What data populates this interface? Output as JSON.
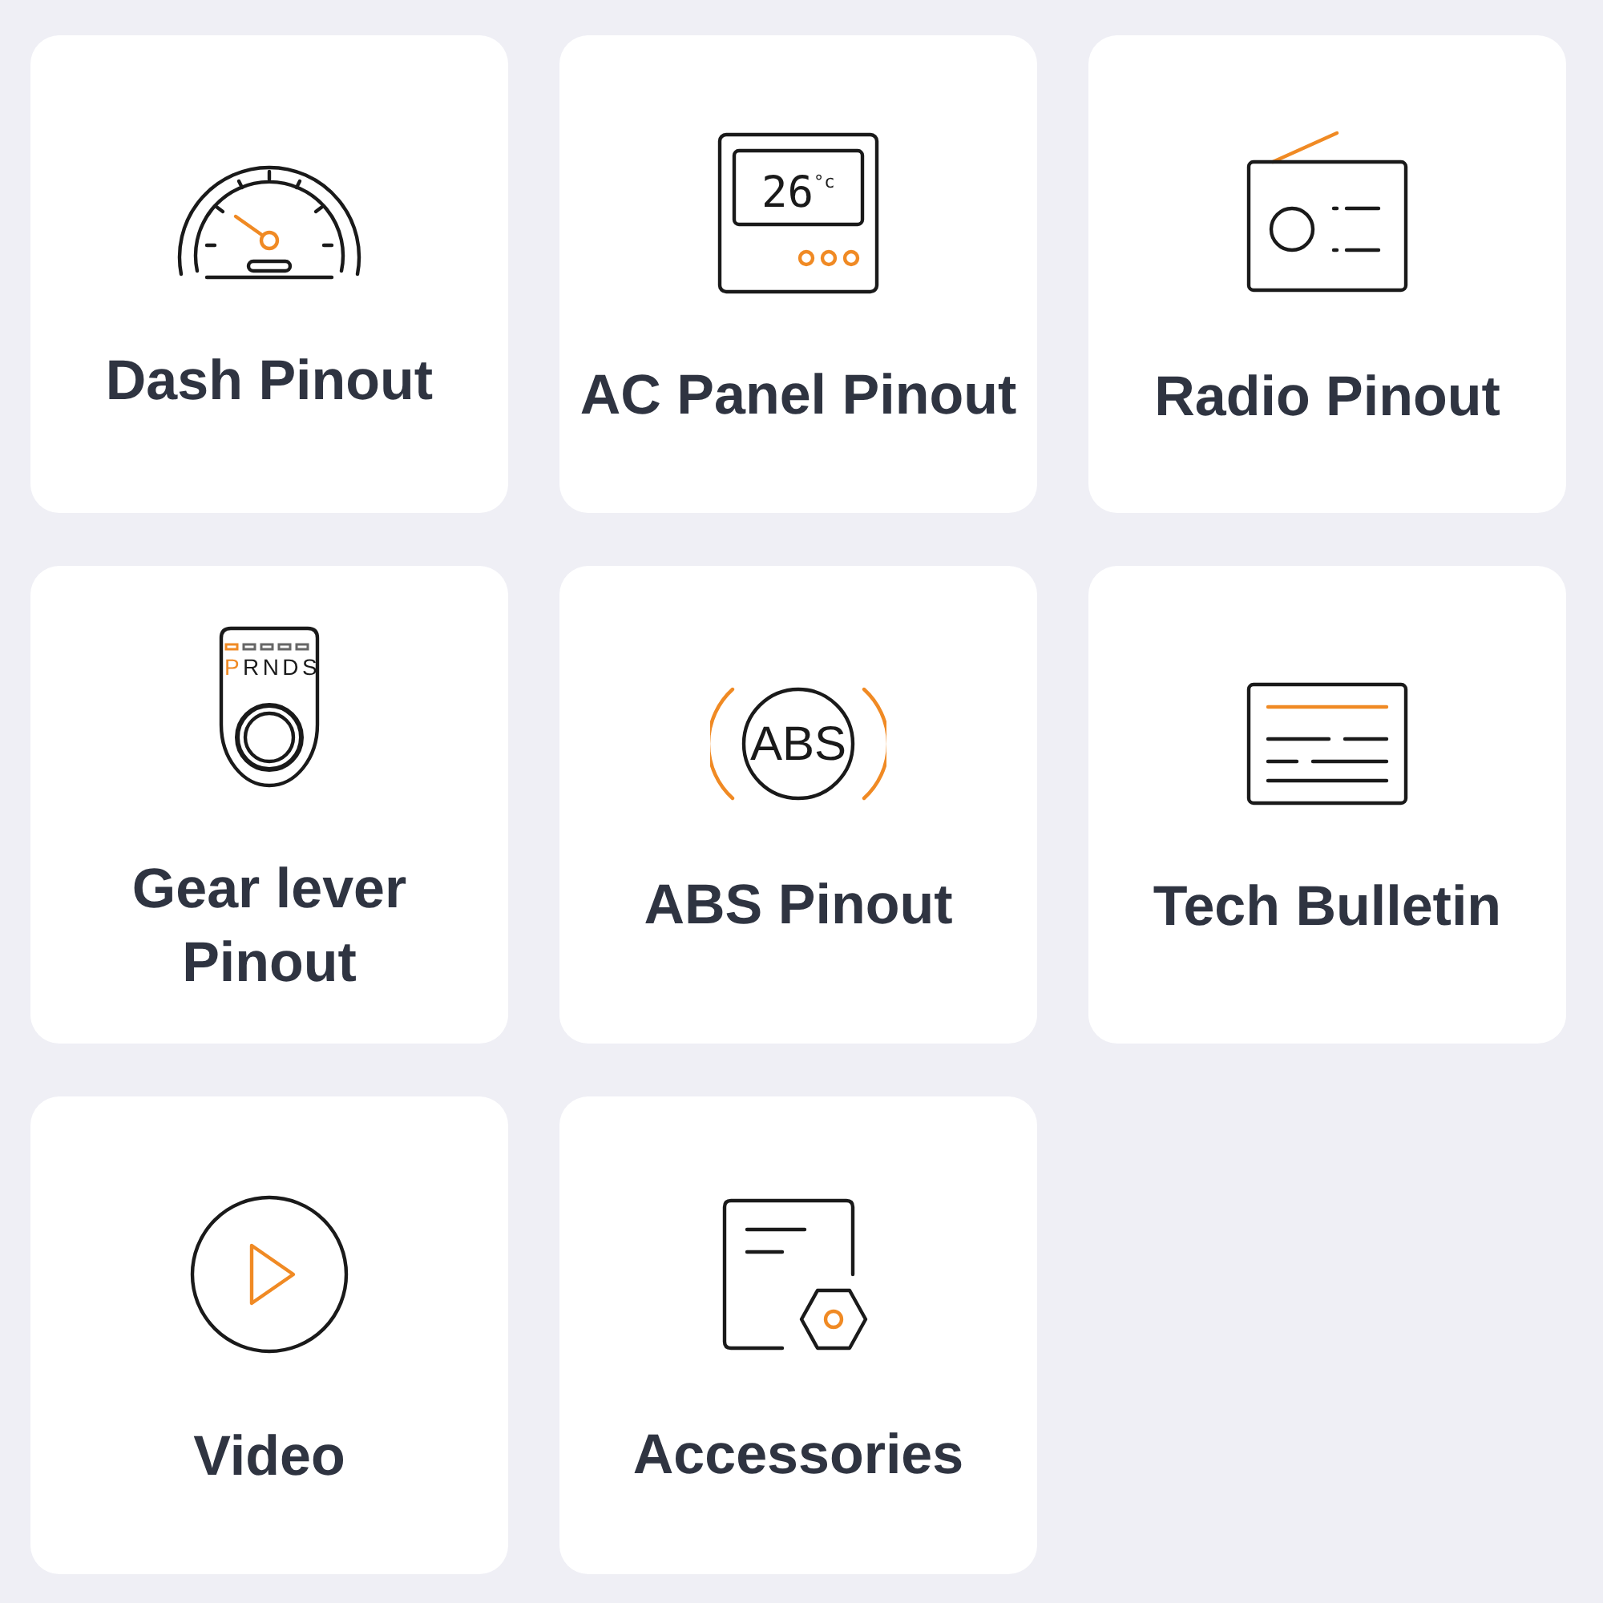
{
  "tiles": [
    {
      "label": "Dash Pinout",
      "kind": "speedometer"
    },
    {
      "label": "AC Panel Pinout",
      "kind": "thermostat",
      "icon_text": [
        "26",
        "°c"
      ]
    },
    {
      "label": "Radio Pinout",
      "kind": "radio"
    },
    {
      "label": "Gear lever Pinout",
      "kind": "gear",
      "icon_text": [
        "P",
        "RNDS"
      ]
    },
    {
      "label": "ABS Pinout",
      "kind": "abs",
      "icon_text": [
        "ABS"
      ]
    },
    {
      "label": "Tech Bulletin",
      "kind": "bulletin"
    },
    {
      "label": "Video",
      "kind": "video"
    },
    {
      "label": "Accessories",
      "kind": "accessories"
    }
  ]
}
